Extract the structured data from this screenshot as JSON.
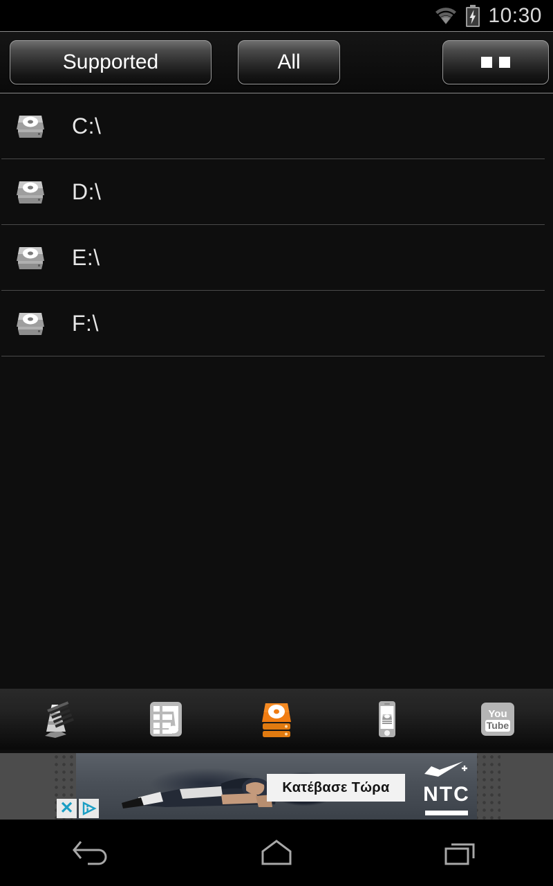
{
  "status_bar": {
    "time": "10:30",
    "wifi_icon": "wifi-icon",
    "battery_icon": "battery-charging-icon"
  },
  "toolbar": {
    "buttons": [
      {
        "label": "Supported",
        "name": "filter-supported",
        "selected": true
      },
      {
        "label": "All",
        "name": "filter-all",
        "selected": false
      }
    ],
    "menu_label": "",
    "menu_icon": "overflow-menu-icon"
  },
  "drives": {
    "icon": "hard-drive-icon",
    "items": [
      {
        "label": "C:\\"
      },
      {
        "label": "D:\\"
      },
      {
        "label": "E:\\"
      },
      {
        "label": "F:\\"
      }
    ]
  },
  "tabbar": {
    "items": [
      {
        "name": "tab-vlc",
        "icon": "vlc-cone-icon",
        "label": "VLC",
        "active": false
      },
      {
        "name": "tab-playlist",
        "icon": "playlist-icon",
        "label": "Playlist",
        "active": false
      },
      {
        "name": "tab-drives",
        "icon": "drive-stack-icon",
        "label": "Drives",
        "active": true
      },
      {
        "name": "tab-device",
        "icon": "phone-icon",
        "label": "Device",
        "active": false
      },
      {
        "name": "tab-youtube",
        "icon": "youtube-icon",
        "label": "YouTube",
        "active": false
      }
    ]
  },
  "ad": {
    "cta_text": "Κατέβασε Τώρα",
    "brand": "NTC",
    "brand_mark": "nike-swoosh-icon",
    "close_label": "✕",
    "adchoices_icon": "adchoices-icon"
  },
  "navbar": {
    "buttons": [
      {
        "name": "nav-back",
        "icon": "back-arrow-icon"
      },
      {
        "name": "nav-home",
        "icon": "home-icon"
      },
      {
        "name": "nav-recents",
        "icon": "recents-icon"
      }
    ]
  },
  "colors": {
    "accent_orange": "#f07c12",
    "background": "#0e0e0e",
    "text": "#e6e6e6",
    "adchoices_blue": "#1b9ec4"
  }
}
